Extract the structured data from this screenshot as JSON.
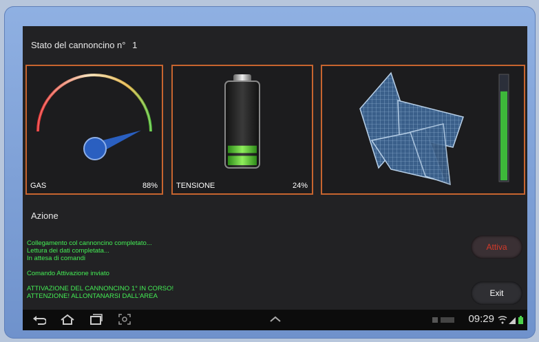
{
  "header": {
    "title": "Stato del cannoncino n°",
    "number": "1"
  },
  "panels": {
    "gas": {
      "label": "GAS",
      "value": "88%",
      "level": 0.88
    },
    "voltage": {
      "label": "TENSIONE",
      "value": "24%",
      "level": 0.24
    },
    "signal": {
      "level": 0.85
    }
  },
  "section": {
    "title": "Azione"
  },
  "log": [
    "Collegamento col cannoncino completato...",
    "Lettura dei dati completata...",
    "In attesa di comandi",
    "",
    "Comando Attivazione inviato",
    "",
    "ATTIVAZIONE DEL CANNONCINO 1° IN CORSO!",
    "ATTENZIONE! ALLONTANARSI DALL'AREA"
  ],
  "buttons": {
    "activate": "Attiva",
    "exit": "Exit"
  },
  "statusbar": {
    "time": "09:29"
  },
  "icons": [
    "back-icon",
    "home-icon",
    "recent-apps-icon",
    "screenshot-icon",
    "chevron-up-icon",
    "wifi-icon",
    "signal-icon",
    "battery-icon"
  ],
  "colors": {
    "accent": "#c8652f",
    "log": "#44ee55",
    "activate": "#d63a2a"
  }
}
